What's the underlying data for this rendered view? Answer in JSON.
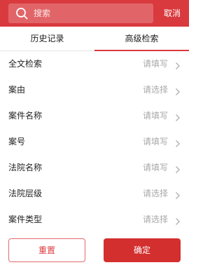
{
  "header": {
    "search_placeholder": "搜索",
    "cancel_label": "取消"
  },
  "tabs": [
    {
      "label": "历史记录",
      "active": false
    },
    {
      "label": "高级检索",
      "active": true
    }
  ],
  "fields": [
    {
      "label": "全文检索",
      "hint": "请填写"
    },
    {
      "label": "案由",
      "hint": "请选择"
    },
    {
      "label": "案件名称",
      "hint": "请填写"
    },
    {
      "label": "案号",
      "hint": "请填写"
    },
    {
      "label": "法院名称",
      "hint": "请填写"
    },
    {
      "label": "法院层级",
      "hint": "请选择"
    },
    {
      "label": "案件类型",
      "hint": "请选择"
    }
  ],
  "footer": {
    "reset_label": "重置",
    "confirm_label": "确定"
  },
  "colors": {
    "accent": "#d93a3e",
    "hint": "#a8a8a8"
  }
}
